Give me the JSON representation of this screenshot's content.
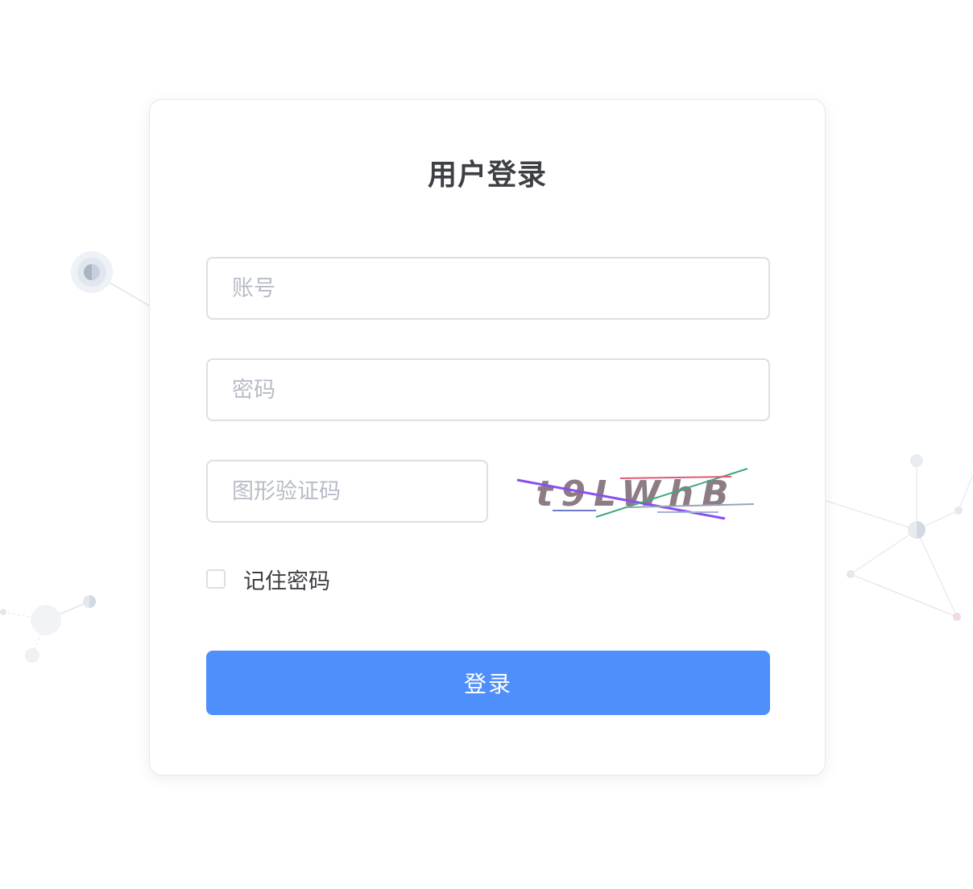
{
  "login": {
    "title": "用户登录",
    "account_placeholder": "账号",
    "password_placeholder": "密码",
    "captcha_placeholder": "图形验证码",
    "captcha_code": "t9LWhB",
    "remember_label": "记住密码",
    "remember_checked": false,
    "submit_label": "登录"
  },
  "colors": {
    "primary": "#4f8ffc",
    "background": "#ffffff",
    "input_border": "#dcdfe6",
    "title_text": "#3d3f44",
    "placeholder_text": "#b8bcc6"
  }
}
